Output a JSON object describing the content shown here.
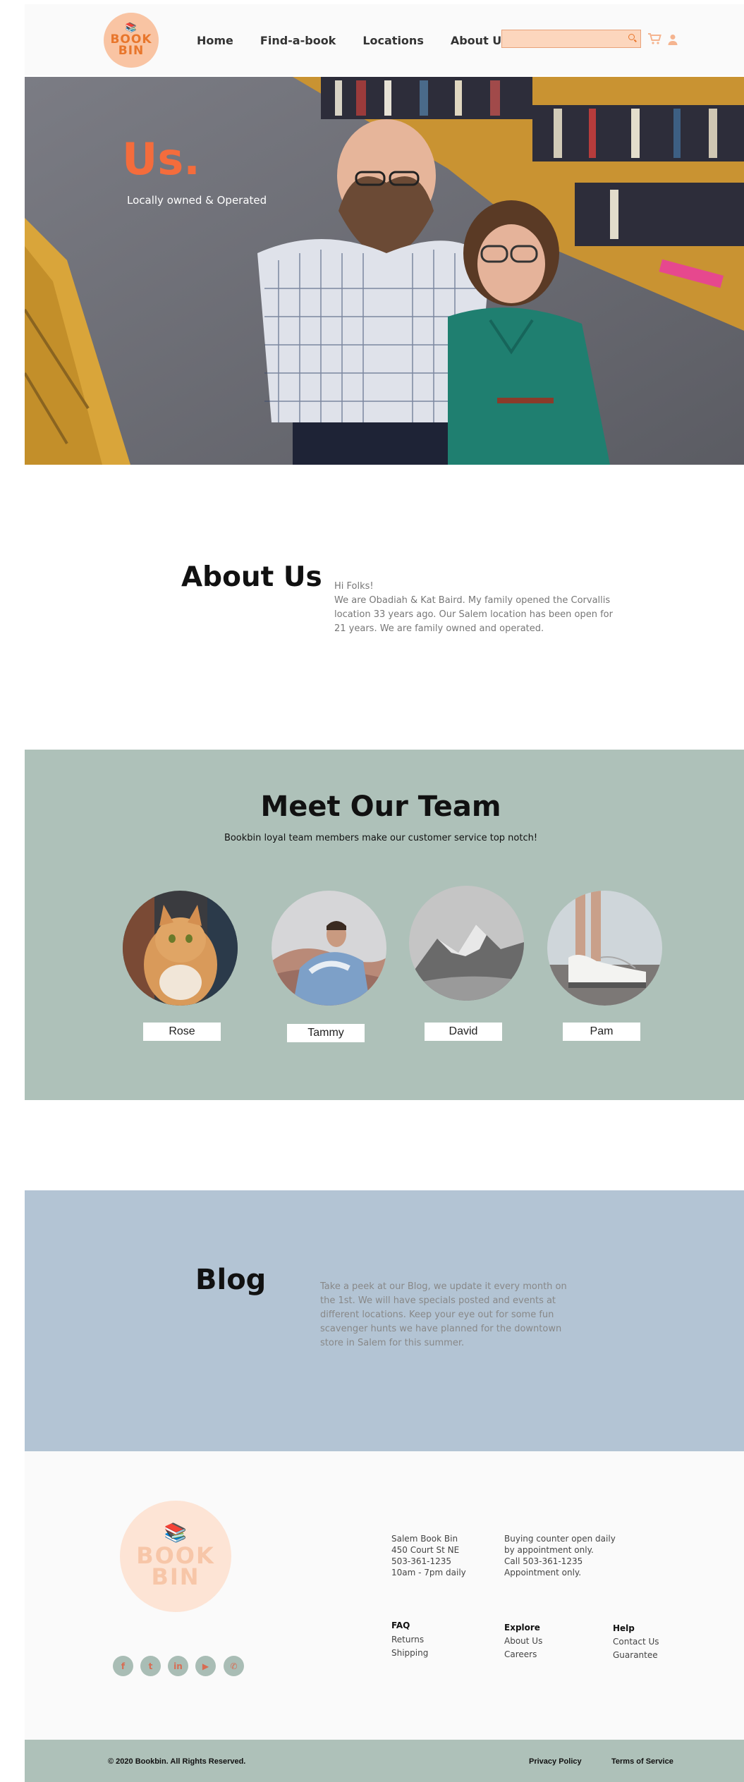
{
  "header": {
    "logo_line1": "BOOK",
    "logo_line2": "BIN",
    "nav": [
      "Home",
      "Find-a-book",
      "Locations",
      "About Us"
    ],
    "search_placeholder": ""
  },
  "hero": {
    "title": "Us.",
    "subtitle": "Locally owned & Operated"
  },
  "about": {
    "title": "About Us",
    "greeting": "Hi Folks!",
    "body": " We are Obadiah & Kat Baird. My family opened the Corvallis location 33 years ago. Our Salem location has been open for 21 years. We are family owned and operated."
  },
  "team": {
    "title": "Meet Our Team",
    "subtitle": "Bookbin loyal team members make our customer service top notch!",
    "members": [
      {
        "name": "Rose"
      },
      {
        "name": "Tammy"
      },
      {
        "name": "David"
      },
      {
        "name": "Pam"
      }
    ]
  },
  "blog": {
    "title": "Blog",
    "body": "Take a peek at our Blog, we update it every month on the 1st. We will have specials posted and  events at different locations. Keep your eye out for some fun scavenger hunts we have planned for the downtown store in Salem for this summer."
  },
  "footer": {
    "logo_line1": "BOOK",
    "logo_line2": "BIN",
    "address": [
      "Salem Book Bin",
      "450 Court St NE",
      "503-361-1235",
      "10am - 7pm daily"
    ],
    "buying": [
      "Buying counter open daily",
      "by appointment only.",
      "Call 503-361-1235",
      "Appointment only."
    ],
    "columns": [
      {
        "head": "FAQ",
        "links": [
          "Returns",
          "Shipping"
        ]
      },
      {
        "head": "Explore",
        "links": [
          "About Us",
          "Careers"
        ]
      },
      {
        "head": "Help",
        "links": [
          "Contact Us",
          "Guarantee"
        ]
      }
    ],
    "social": [
      {
        "icon": "facebook-icon",
        "glyph": "f"
      },
      {
        "icon": "twitter-icon",
        "glyph": "t"
      },
      {
        "icon": "linkedin-icon",
        "glyph": "in"
      },
      {
        "icon": "youtube-icon",
        "glyph": "▶"
      },
      {
        "icon": "phone-icon",
        "glyph": "✆"
      }
    ]
  },
  "bottom": {
    "copyright": "© 2020 Bookbin.  All Rights Reserved.",
    "privacy": "Privacy Policy",
    "terms": "Terms of Service"
  },
  "colors": {
    "accent": "#f46c3c",
    "logo_bg": "#f9c4a3",
    "team_bg": "#aec1b9",
    "blog_bg": "#b3c4d4"
  }
}
